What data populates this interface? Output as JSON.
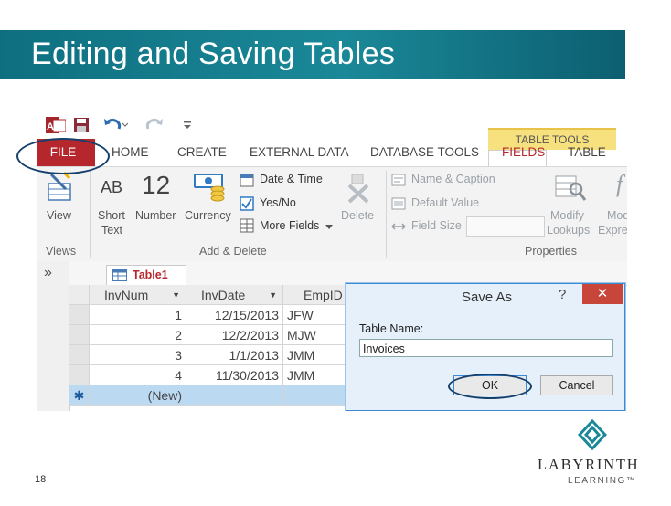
{
  "slide": {
    "title": "Editing and Saving Tables",
    "page_number": "18",
    "logo": {
      "name": "LABYRINTH",
      "sub": "LEARNING™"
    }
  },
  "ribbon": {
    "contextual_group": "TABLE TOOLS",
    "tabs": [
      "FILE",
      "HOME",
      "CREATE",
      "EXTERNAL DATA",
      "DATABASE TOOLS",
      "FIELDS",
      "TABLE"
    ],
    "active_tab": "FIELDS",
    "commands": {
      "view": "View",
      "short_text": [
        "Short",
        "Text"
      ],
      "short_text_glyph": "AB",
      "number": "Number",
      "number_glyph": "12",
      "currency": "Currency",
      "date_time": "Date & Time",
      "yes_no": "Yes/No",
      "more_fields": "More Fields",
      "delete": "Delete",
      "name_caption": "Name & Caption",
      "default_value": "Default Value",
      "field_size": "Field Size",
      "modify_lookups": [
        "Modify",
        "Lookups"
      ],
      "modify_expression": [
        "Mod",
        "Expre"
      ]
    },
    "groups": [
      "Views",
      "Add & Delete",
      "Properties"
    ]
  },
  "datasheet": {
    "tab_label": "Table1",
    "nav_toggle": "»",
    "columns": [
      "InvNum",
      "InvDate",
      "EmpID"
    ],
    "rows": [
      {
        "num": "1",
        "date": "12/15/2013",
        "emp": "JFW"
      },
      {
        "num": "2",
        "date": "12/2/2013",
        "emp": "MJW"
      },
      {
        "num": "3",
        "date": "1/1/2013",
        "emp": "JMM"
      },
      {
        "num": "4",
        "date": "11/30/2013",
        "emp": "JMM"
      }
    ],
    "new_row_label": "(New)",
    "new_row_marker": "✱"
  },
  "dialog": {
    "title": "Save As",
    "help": "?",
    "close": "✕",
    "label": "Table Name:",
    "value": "Invoices",
    "ok": "OK",
    "cancel": "Cancel"
  },
  "colors": {
    "title_bar": "#1a8898",
    "file_tab": "#b5272d",
    "table_tools": "#f7e07e",
    "highlight_oval": "#16406b",
    "new_row": "#bcd9f2"
  }
}
